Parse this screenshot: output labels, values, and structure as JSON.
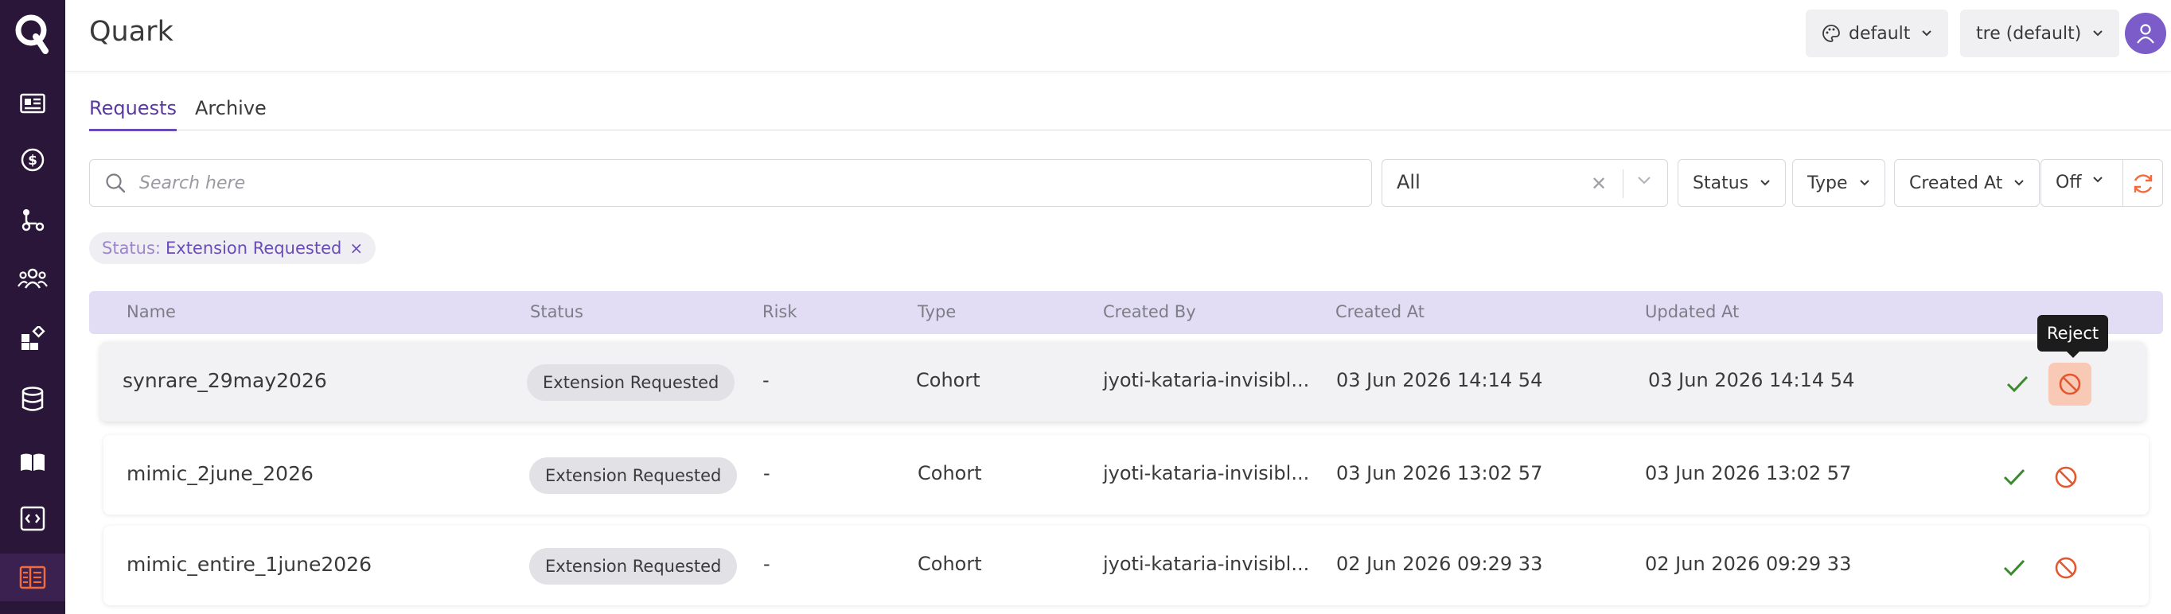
{
  "app": {
    "title": "Quark",
    "logo_letter": "Q"
  },
  "sidebar": {
    "items": [
      {
        "icon": "news-card-icon"
      },
      {
        "icon": "dollar-circle-icon"
      },
      {
        "icon": "workflow-nodes-icon"
      },
      {
        "icon": "people-group-icon"
      },
      {
        "icon": "apps-grid-icon"
      },
      {
        "icon": "database-icon"
      },
      {
        "icon": "book-open-icon"
      },
      {
        "icon": "code-brackets-icon"
      },
      {
        "icon": "request-list-icon",
        "active": true
      }
    ],
    "active_color": "#f36b3c"
  },
  "header": {
    "theme_label": "default",
    "workspace_label": "tre (default)"
  },
  "tabs": [
    {
      "label": "Requests",
      "active": true
    },
    {
      "label": "Archive",
      "active": false
    }
  ],
  "filters": {
    "search_placeholder": "Search here",
    "scope_value": "All",
    "status_label": "Status",
    "type_label": "Type",
    "created_at_label": "Created At",
    "auto_refresh_label": "Off"
  },
  "active_filter_chip": {
    "key": "Status:",
    "value": "Extension Requested",
    "remove": "×"
  },
  "table": {
    "columns": [
      "Name",
      "Status",
      "Risk",
      "Type",
      "Created By",
      "Created At",
      "Updated At"
    ],
    "rows": [
      {
        "name": "synrare_29may2026",
        "status": "Extension Requested",
        "risk": "-",
        "type": "Cohort",
        "created_by": "jyoti-kataria-invisibl...",
        "created_at": "03 Jun 2026 14:14 54",
        "updated_at": "03 Jun 2026 14:14 54"
      },
      {
        "name": "mimic_2june_2026",
        "status": "Extension Requested",
        "risk": "-",
        "type": "Cohort",
        "created_by": "jyoti-kataria-invisibl...",
        "created_at": "03 Jun 2026 13:02 57",
        "updated_at": "03 Jun 2026 13:02 57"
      },
      {
        "name": "mimic_entire_1june2026",
        "status": "Extension Requested",
        "risk": "-",
        "type": "Cohort",
        "created_by": "jyoti-kataria-invisibl...",
        "created_at": "02 Jun 2026 09:29 33",
        "updated_at": "02 Jun 2026 09:29 33"
      }
    ]
  },
  "tooltip": {
    "text": "Reject"
  },
  "colors": {
    "sidebar_bg": "#2a1638",
    "accent": "#6a4cb8",
    "approve": "#3c8a2e",
    "reject": "#e4572e",
    "header_row_bg": "#e3dcf5"
  }
}
